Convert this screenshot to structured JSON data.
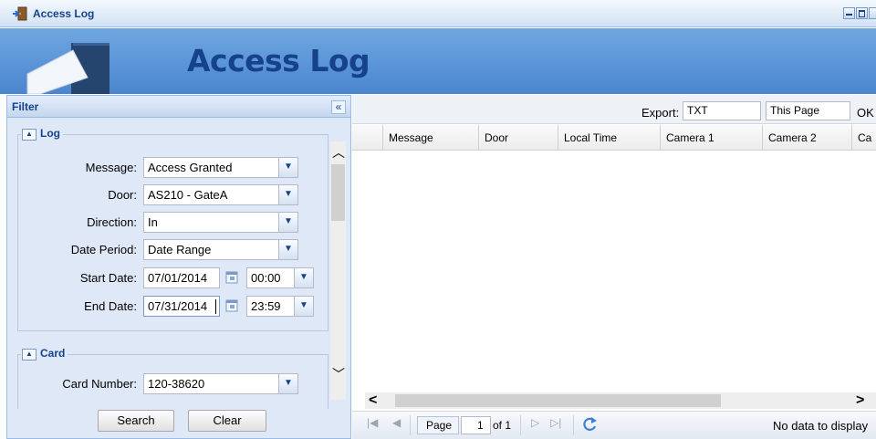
{
  "window": {
    "title": "Access Log"
  },
  "banner": {
    "title": "Access Log"
  },
  "filter": {
    "title": "Filter",
    "collapse_glyph": "«",
    "log_section": {
      "legend": "Log",
      "fields": {
        "message": {
          "label": "Message:",
          "value": "Access Granted"
        },
        "door": {
          "label": "Door:",
          "value": "AS210 - GateA"
        },
        "direction": {
          "label": "Direction:",
          "value": "In"
        },
        "date_period": {
          "label": "Date Period:",
          "value": "Date Range"
        },
        "start_date": {
          "label": "Start Date:",
          "date": "07/01/2014",
          "time": "00:00"
        },
        "end_date": {
          "label": "End Date:",
          "date": "07/31/2014",
          "time": "23:59"
        }
      }
    },
    "card_section": {
      "legend": "Card",
      "fields": {
        "card_number": {
          "label": "Card Number:",
          "value": "120-38620"
        }
      }
    },
    "search_label": "Search",
    "clear_label": "Clear"
  },
  "grid": {
    "export_label": "Export:",
    "export_format": "TXT",
    "export_scope": "This Page",
    "ok_label": "OK",
    "columns": [
      "Message",
      "Door",
      "Local Time",
      "Camera 1",
      "Camera 2",
      "Ca"
    ],
    "paging": {
      "page_label": "Page",
      "page_value": "1",
      "of_label": "of 1",
      "status": "No data to display"
    }
  }
}
